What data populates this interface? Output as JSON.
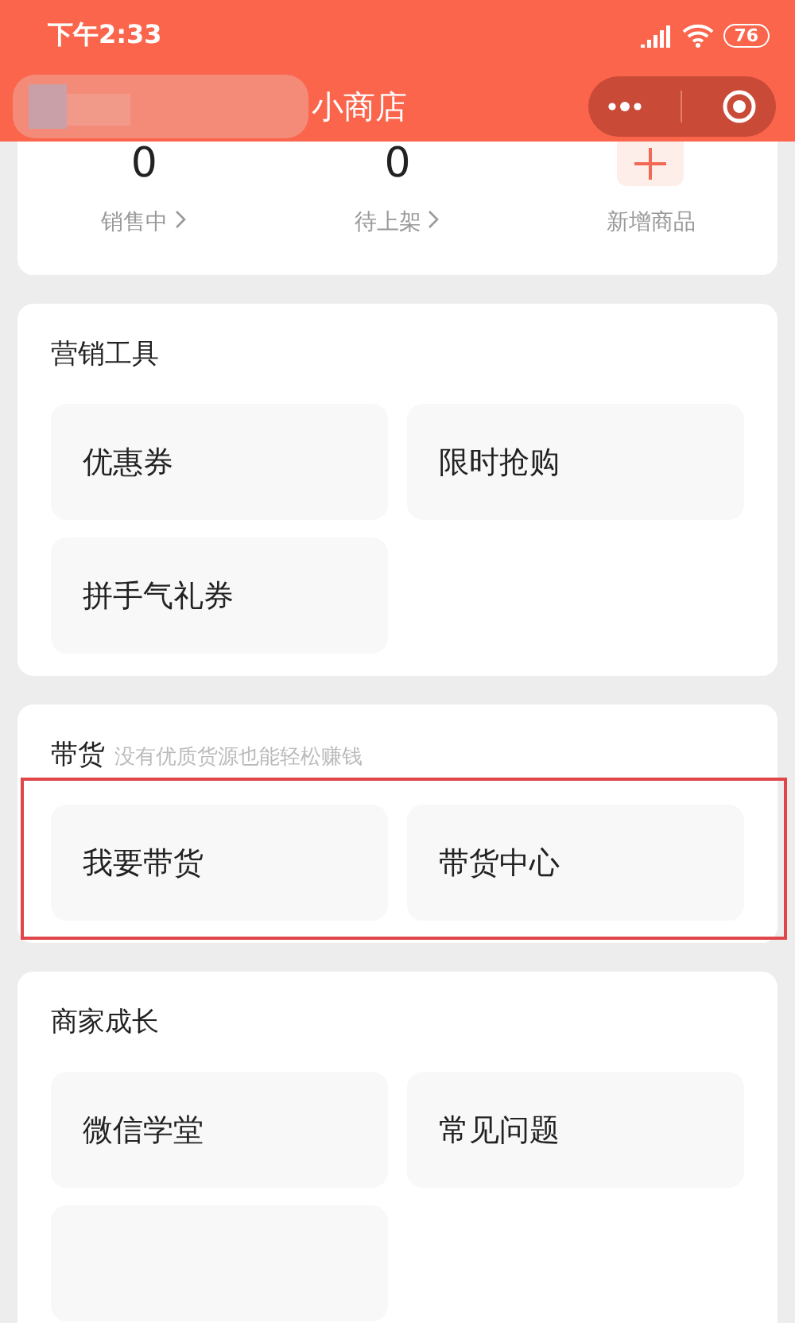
{
  "status_bar": {
    "time": "下午2:33",
    "battery": "76"
  },
  "header": {
    "title": "小商店",
    "name_obscured": true
  },
  "stats": [
    {
      "value": "0",
      "label": "销售中",
      "has_arrow": true
    },
    {
      "value": "0",
      "label": "待上架",
      "has_arrow": true
    },
    {
      "kind": "add",
      "label": "新增商品",
      "has_arrow": false
    }
  ],
  "sections": [
    {
      "title": "营销工具",
      "tiles": [
        {
          "kind": "text",
          "label": "优惠券"
        },
        {
          "kind": "text",
          "label": "限时抢购"
        },
        {
          "kind": "text",
          "label": "拼手气礼券"
        }
      ],
      "highlighted": false
    },
    {
      "title": "带货",
      "subtitle": "没有优质货源也能轻松赚钱",
      "tiles": [
        {
          "kind": "text",
          "label": "我要带货"
        },
        {
          "kind": "text",
          "label": "带货中心"
        }
      ],
      "highlighted": true
    },
    {
      "title": "商家成长",
      "tiles": [
        {
          "kind": "text",
          "label": "微信学堂"
        },
        {
          "kind": "text",
          "label": "常见问题"
        },
        {
          "kind": "empty"
        }
      ],
      "highlighted": false
    }
  ]
}
